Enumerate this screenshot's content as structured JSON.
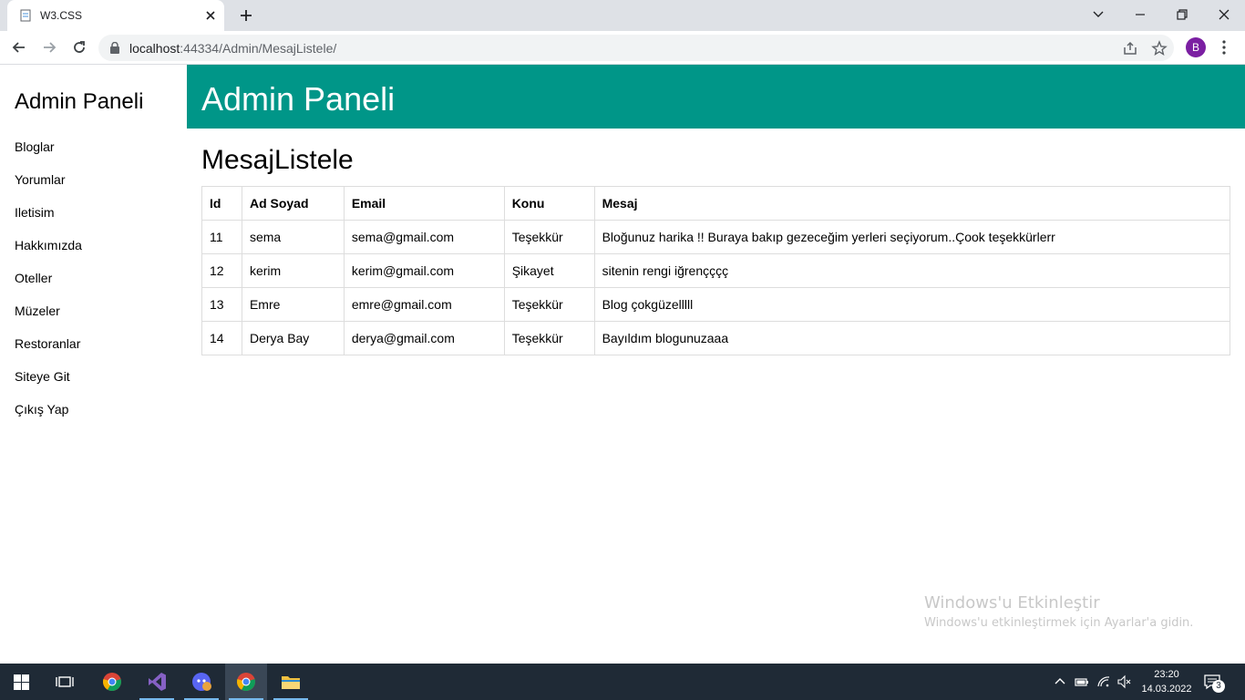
{
  "browser": {
    "tab_title": "W3.CSS",
    "url_host": "localhost",
    "url_rest": ":44334/Admin/MesajListele/",
    "profile_initial": "B"
  },
  "sidebar": {
    "title": "Admin Paneli",
    "items": [
      {
        "label": "Bloglar"
      },
      {
        "label": "Yorumlar"
      },
      {
        "label": "Iletisim"
      },
      {
        "label": "Hakkımızda"
      },
      {
        "label": "Oteller"
      },
      {
        "label": "Müzeler"
      },
      {
        "label": "Restoranlar"
      },
      {
        "label": "Siteye Git"
      },
      {
        "label": "Çıkış Yap"
      }
    ]
  },
  "header": {
    "title": "Admin Paneli"
  },
  "main": {
    "title": "MesajListele",
    "columns": [
      "Id",
      "Ad Soyad",
      "Email",
      "Konu",
      "Mesaj"
    ],
    "rows": [
      [
        "11",
        "sema",
        "sema@gmail.com",
        "Teşekkür",
        "Bloğunuz harika !! Buraya bakıp gezeceğim yerleri seçiyorum..Çook teşekkürlerr"
      ],
      [
        "12",
        "kerim",
        "kerim@gmail.com",
        "Şikayet",
        "sitenin rengi iğrençççç"
      ],
      [
        "13",
        "Emre",
        "emre@gmail.com",
        "Teşekkür",
        "Blog çokgüzelllll"
      ],
      [
        "14",
        "Derya Bay",
        "derya@gmail.com",
        "Teşekkür",
        "Bayıldım blogunuzaaa"
      ]
    ]
  },
  "watermark": {
    "title": "Windows'u Etkinleştir",
    "subtitle": "Windows'u etkinleştirmek için Ayarlar'a gidin."
  },
  "taskbar": {
    "time": "23:20",
    "date": "14.03.2022",
    "notification_count": "3"
  },
  "colors": {
    "header_bg": "#009688",
    "taskbar_bg": "#1f2a36",
    "avatar_bg": "#7b1fa2"
  }
}
